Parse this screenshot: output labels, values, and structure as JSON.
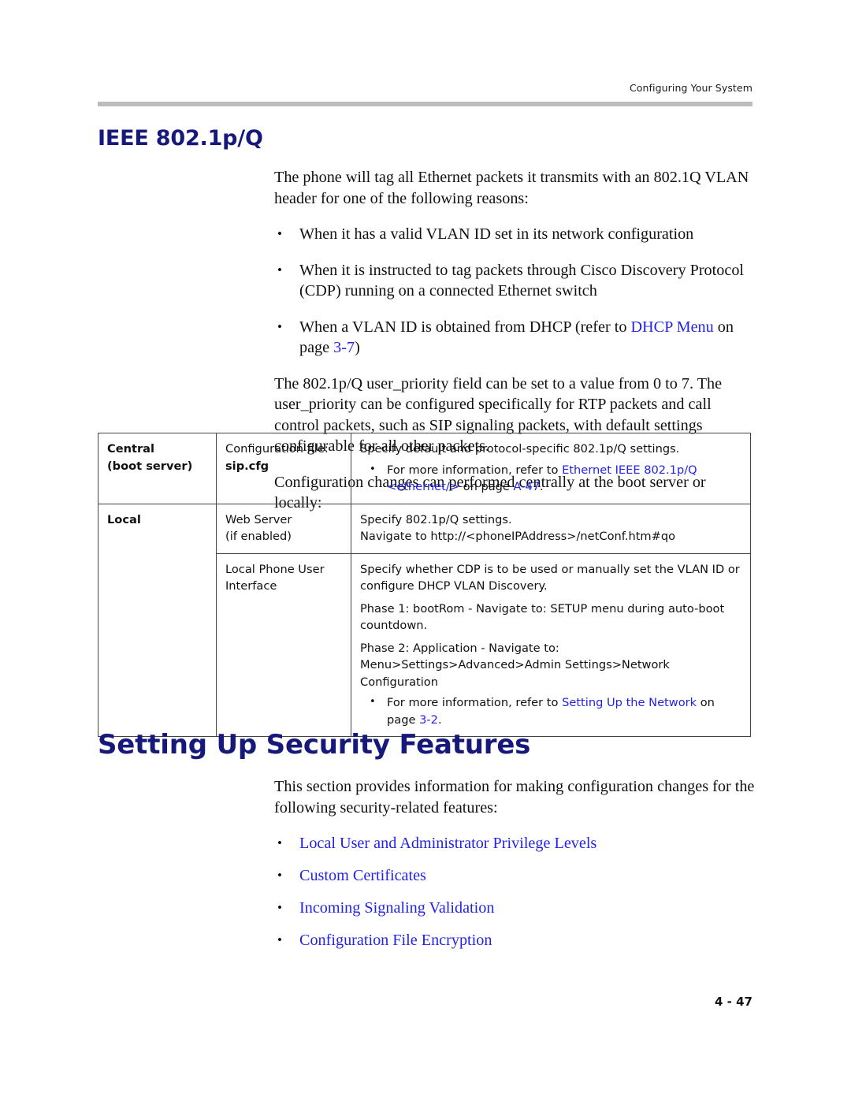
{
  "header": {
    "running_title": "Configuring Your System"
  },
  "sections": {
    "ieee": {
      "heading": "IEEE 802.1p/Q",
      "intro": "The phone will tag all Ethernet packets it transmits with an 802.1Q VLAN header for one of the following reasons:",
      "bullets": [
        {
          "text": "When it has a valid VLAN ID set in its network configuration"
        },
        {
          "text": "When it is instructed to tag packets through Cisco Discovery Protocol (CDP) running on a connected Ethernet switch"
        },
        {
          "prefix": "When a VLAN ID is obtained from DHCP (refer to ",
          "link": "DHCP Menu",
          "middle": " on page ",
          "link2": "3-7",
          "suffix": ")"
        }
      ],
      "para_priority": "The 802.1p/Q user_priority field can be set to a value from 0 to 7. The user_priority can be configured specifically for RTP packets and call control packets, such as SIP signaling packets, with default settings configurable for all other packets.",
      "para_changes": "Configuration changes can performed centrally at the boot server or locally:"
    },
    "security": {
      "heading": "Setting Up Security Features",
      "intro": "This section provides information for making configuration changes for the following security-related features:",
      "links": [
        "Local User and Administrator Privilege Levels",
        "Custom Certificates",
        "Incoming Signaling Validation",
        "Configuration File Encryption"
      ]
    }
  },
  "config_table": {
    "rows": [
      {
        "scope": "Central",
        "scope_line2": "(boot server)",
        "method_label": "Configuration file:",
        "method_value": "sip.cfg",
        "desc_intro": "Specify default and protocol-specific 802.1p/Q settings.",
        "bullet_prefix": "For more information, refer to ",
        "bullet_link": "Ethernet IEEE 802.1p/Q <ethernet/>",
        "bullet_middle": " on page ",
        "bullet_link2": "A-47",
        "bullet_suffix": "."
      },
      {
        "scope": "Local",
        "scope_line2": "",
        "method_label": "Web Server",
        "method_value": "(if enabled)",
        "desc_intro": "Specify 802.1p/Q settings.",
        "desc_line2": "Navigate to http://<phoneIPAddress>/netConf.htm#qo"
      },
      {
        "scope": "",
        "scope_line2": "",
        "method_label": "Local Phone User",
        "method_value": "Interface",
        "desc_intro": "Specify whether CDP is to be used or manually set the VLAN ID or configure DHCP VLAN Discovery.",
        "desc_phase1": "Phase 1: bootRom - Navigate to: SETUP menu during auto-boot countdown.",
        "desc_phase2_a": "Phase 2: Application - Navigate to:",
        "desc_phase2_b": "Menu>Settings>Advanced>Admin Settings>Network Configuration",
        "bullet_prefix": "For more information, refer to ",
        "bullet_link": "Setting Up the Network",
        "bullet_middle": " on page ",
        "bullet_link2": "3-2",
        "bullet_suffix": "."
      }
    ]
  },
  "footer": {
    "page_number": "4 - 47"
  },
  "colors": {
    "heading_navy": "#16197a",
    "link_blue": "#2323e6",
    "rule_grey": "#bcbcbc",
    "table_border": "#444444"
  }
}
